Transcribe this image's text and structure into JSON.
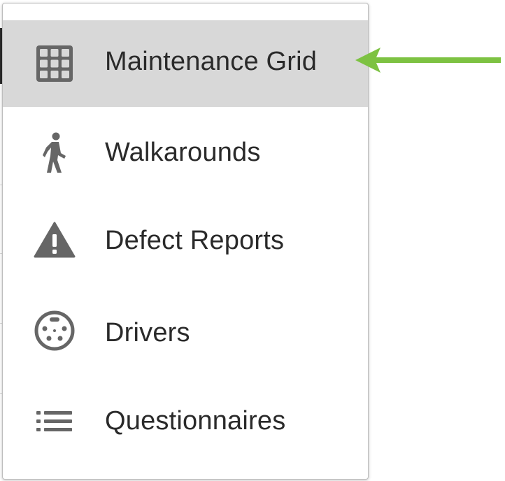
{
  "menu": {
    "items": [
      {
        "label": "Maintenance Grid",
        "icon": "grid-icon",
        "active": true
      },
      {
        "label": "Walkarounds",
        "icon": "walking-person-icon",
        "active": false
      },
      {
        "label": "Defect Reports",
        "icon": "warning-triangle-icon",
        "active": false
      },
      {
        "label": "Drivers",
        "icon": "steering-wheel-icon",
        "active": false
      },
      {
        "label": "Questionnaires",
        "icon": "list-icon",
        "active": false
      }
    ]
  },
  "colors": {
    "active_background": "#d8d8d8",
    "icon": "#666666",
    "text": "#2a2a2a",
    "arrow": "#7dc242"
  },
  "annotation": {
    "arrow_icon": "arrow-left-icon"
  }
}
